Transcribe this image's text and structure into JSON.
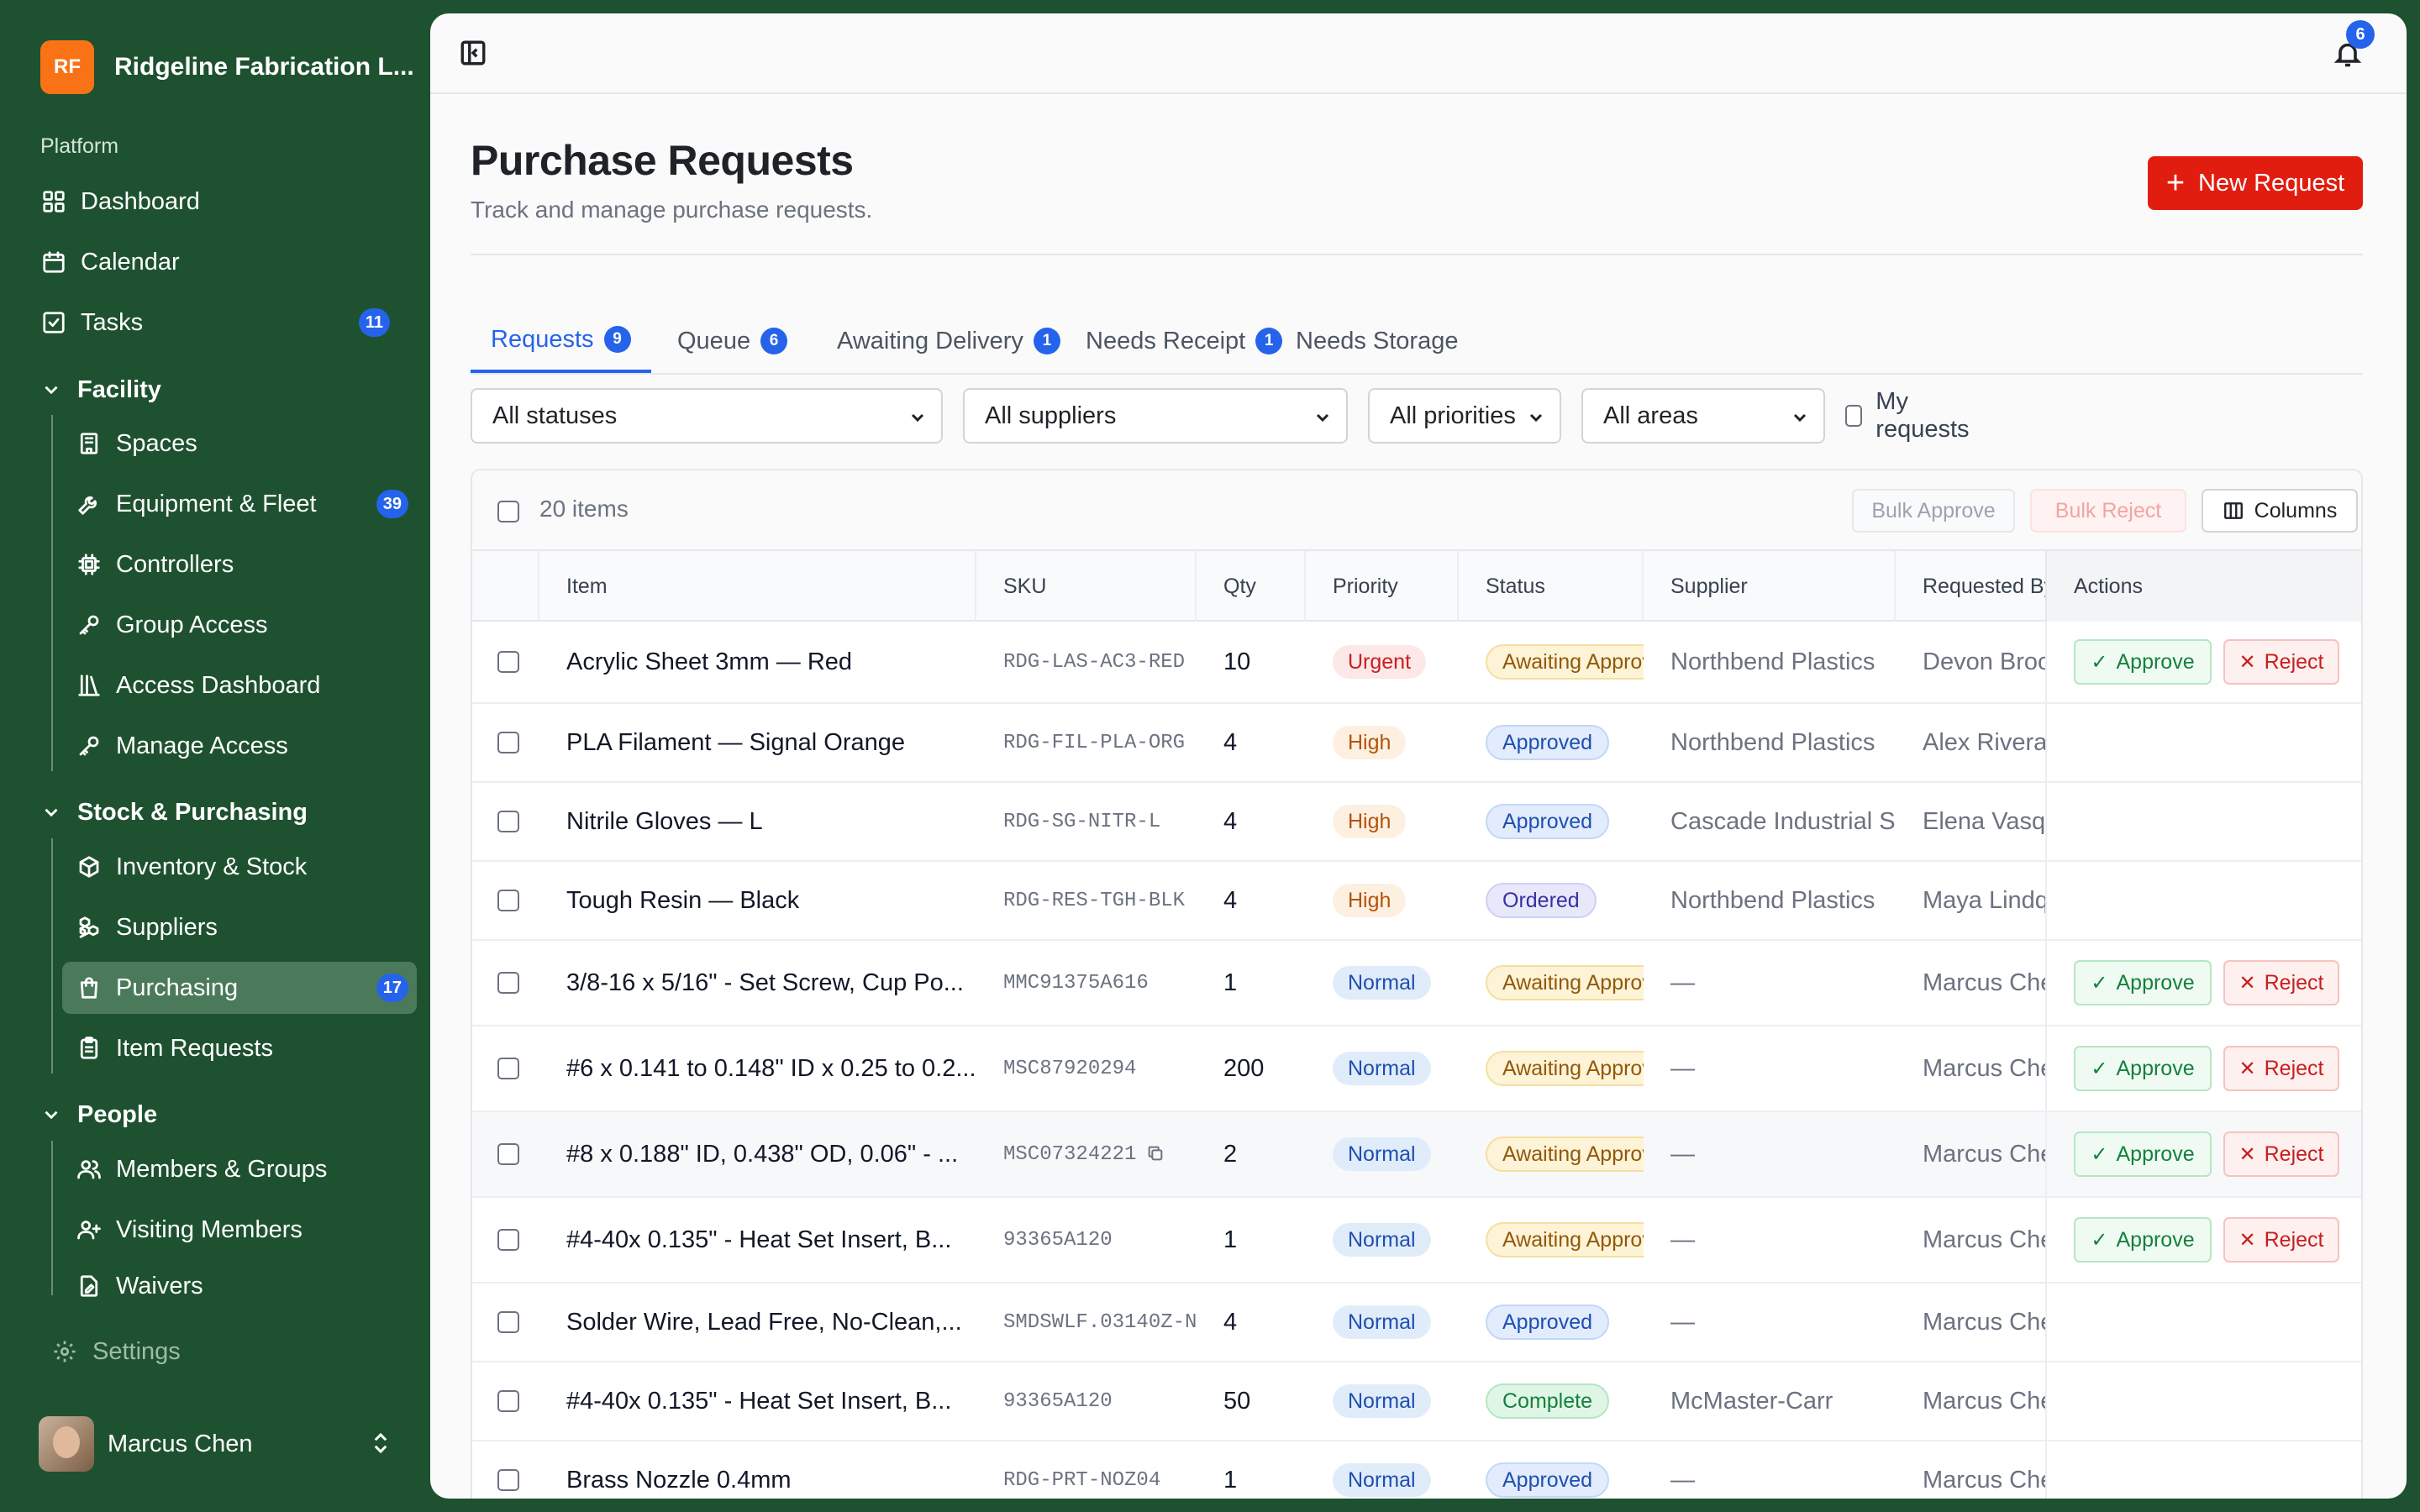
{
  "org": {
    "initials": "RF",
    "name": "Ridgeline Fabrication L..."
  },
  "sidebar": {
    "group_label": "Platform",
    "top_items": [
      {
        "label": "Dashboard",
        "icon": "grid-icon"
      },
      {
        "label": "Calendar",
        "icon": "calendar-icon"
      },
      {
        "label": "Tasks",
        "icon": "check-square-icon",
        "badge": "11"
      }
    ],
    "sections": [
      {
        "title": "Facility",
        "items": [
          {
            "label": "Spaces",
            "icon": "building-icon"
          },
          {
            "label": "Equipment & Fleet",
            "icon": "wrench-icon",
            "badge": "39"
          },
          {
            "label": "Controllers",
            "icon": "chip-icon"
          },
          {
            "label": "Group Access",
            "icon": "key-icon"
          },
          {
            "label": "Access Dashboard",
            "icon": "library-icon"
          },
          {
            "label": "Manage Access",
            "icon": "key-icon"
          }
        ]
      },
      {
        "title": "Stock & Purchasing",
        "items": [
          {
            "label": "Inventory & Stock",
            "icon": "package-icon"
          },
          {
            "label": "Suppliers",
            "icon": "boxes-icon"
          },
          {
            "label": "Purchasing",
            "icon": "shopping-bag-icon",
            "badge": "17",
            "active": true
          },
          {
            "label": "Item Requests",
            "icon": "clipboard-icon"
          }
        ]
      },
      {
        "title": "People",
        "items": [
          {
            "label": "Members & Groups",
            "icon": "users-icon"
          },
          {
            "label": "Visiting Members",
            "icon": "user-plus-icon"
          },
          {
            "label": "Waivers",
            "icon": "file-signature-icon"
          }
        ]
      }
    ],
    "settings_label": "Settings",
    "user_name": "Marcus Chen"
  },
  "topbar": {
    "notification_count": "6"
  },
  "page": {
    "title": "Purchase Requests",
    "subtitle": "Track and manage purchase requests.",
    "new_button": "New Request"
  },
  "tabs": [
    {
      "label": "Requests",
      "count": "9",
      "active": true
    },
    {
      "label": "Queue",
      "count": "6"
    },
    {
      "label": "Awaiting Delivery",
      "count": "1"
    },
    {
      "label": "Needs Receipt",
      "count": "1"
    },
    {
      "label": "Needs Storage",
      "count": ""
    }
  ],
  "filters": {
    "status": "All statuses",
    "supplier": "All suppliers",
    "priority": "All priorities",
    "area": "All areas",
    "my_requests": "My requests"
  },
  "table": {
    "items_count": "20 items",
    "bulk_approve": "Bulk Approve",
    "bulk_reject": "Bulk Reject",
    "columns_button": "Columns",
    "headers": [
      "Item",
      "SKU",
      "Qty",
      "Priority",
      "Status",
      "Supplier",
      "Requested By",
      "Actions"
    ],
    "approve_label": "Approve",
    "reject_label": "Reject",
    "rows": [
      {
        "item": "Acrylic Sheet 3mm — Red",
        "sku": "RDG-LAS-AC3-RED",
        "qty": "10",
        "priority": "Urgent",
        "status": "Awaiting Approval",
        "supplier": "Northbend Plastics",
        "requested_by": "Devon Brooks",
        "actions": true
      },
      {
        "item": "PLA Filament — Signal Orange",
        "sku": "RDG-FIL-PLA-ORG",
        "qty": "4",
        "priority": "High",
        "status": "Approved",
        "supplier": "Northbend Plastics",
        "requested_by": "Alex Rivera",
        "actions": false
      },
      {
        "item": "Nitrile Gloves — L",
        "sku": "RDG-SG-NITR-L",
        "qty": "4",
        "priority": "High",
        "status": "Approved",
        "supplier": "Cascade Industrial Supply",
        "requested_by": "Elena Vasquez",
        "actions": false
      },
      {
        "item": "Tough Resin — Black",
        "sku": "RDG-RES-TGH-BLK",
        "qty": "4",
        "priority": "High",
        "status": "Ordered",
        "supplier": "Northbend Plastics",
        "requested_by": "Maya Lindqvist",
        "actions": false
      },
      {
        "item": "3/8-16 x 5/16\" - Set Screw, Cup Po...",
        "sku": "MMC91375A616",
        "qty": "1",
        "priority": "Normal",
        "status": "Awaiting Approval",
        "supplier": "—",
        "requested_by": "Marcus Chen",
        "actions": true
      },
      {
        "item": "#6 x 0.141 to 0.148\" ID x 0.25 to 0.2...",
        "sku": "MSC87920294",
        "qty": "200",
        "priority": "Normal",
        "status": "Awaiting Approval",
        "supplier": "—",
        "requested_by": "Marcus Chen",
        "actions": true
      },
      {
        "item": "#8 x 0.188\" ID, 0.438\" OD, 0.06\" - ...",
        "sku": "MSC07324221",
        "qty": "2",
        "priority": "Normal",
        "status": "Awaiting Approval",
        "supplier": "—",
        "requested_by": "Marcus Chen",
        "actions": true,
        "copy_icon": true
      },
      {
        "item": "#4-40x 0.135\" - Heat Set Insert, B...",
        "sku": "93365A120",
        "qty": "1",
        "priority": "Normal",
        "status": "Awaiting Approval",
        "supplier": "—",
        "requested_by": "Marcus Chen",
        "actions": true
      },
      {
        "item": "Solder Wire, Lead Free, No-Clean,...",
        "sku": "SMDSWLF.03140Z-N",
        "qty": "4",
        "priority": "Normal",
        "status": "Approved",
        "supplier": "—",
        "requested_by": "Marcus Chen",
        "actions": false
      },
      {
        "item": "#4-40x 0.135\" - Heat Set Insert, B...",
        "sku": "93365A120",
        "qty": "50",
        "priority": "Normal",
        "status": "Complete",
        "supplier": "McMaster-Carr",
        "requested_by": "Marcus Chen",
        "actions": false
      },
      {
        "item": "Brass Nozzle 0.4mm",
        "sku": "RDG-PRT-NOZ04",
        "qty": "1",
        "priority": "Normal",
        "status": "Approved",
        "supplier": "—",
        "requested_by": "Marcus Chen",
        "actions": false
      }
    ]
  },
  "colors": {
    "sidebar_bg": "#1e5130",
    "primary": "#e11d10",
    "accent": "#2563eb"
  }
}
